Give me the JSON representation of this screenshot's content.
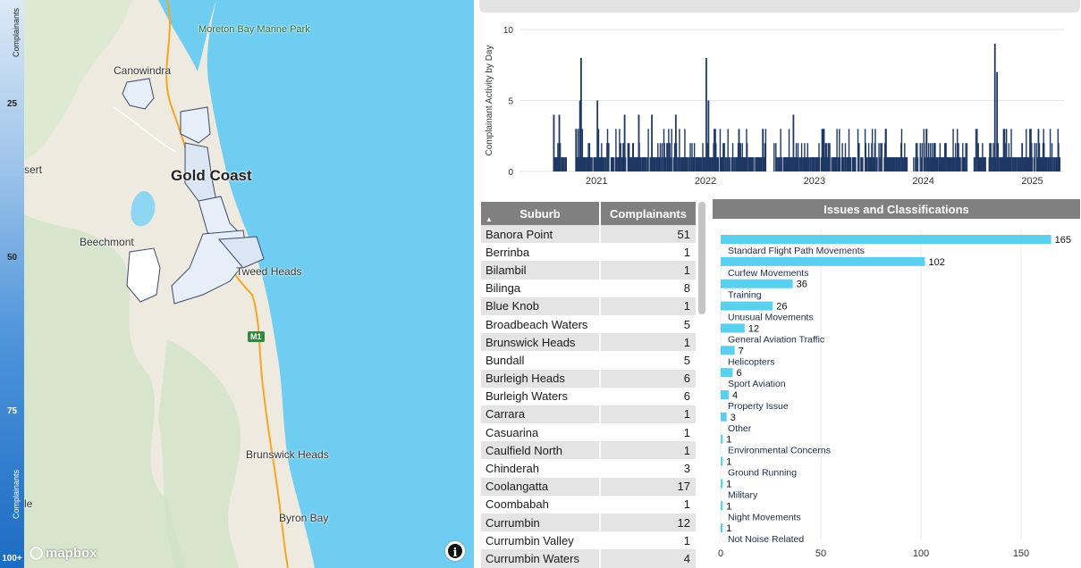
{
  "legend": {
    "ticks": [
      "25",
      "50",
      "75",
      "100+"
    ],
    "label": "Complainants"
  },
  "map": {
    "labels": {
      "moreton_bay": "Moreton Bay Marine Park",
      "canowindra": "Canowindra",
      "gold_coast": "Gold Coast",
      "beechmont": "Beechmont",
      "tweed_heads": "Tweed Heads",
      "brunswick_heads": "Brunswick Heads",
      "byron_bay": "Byron Bay",
      "sert": "sert",
      "le": "le"
    },
    "highway_shield": "M1",
    "logo": "mapbox",
    "info": "i",
    "colors": {
      "water": "#6ecdf0",
      "land": "#eeeadf",
      "hills": "#cfe3c5",
      "region_fill": "#e6eef8",
      "region_stroke": "#3a4a6e",
      "road": "#f5a623"
    }
  },
  "activity_chart": {
    "chart_data": {
      "type": "bar",
      "ylabel": "Complainant Activity by Day",
      "yticks": [
        0,
        5,
        10
      ],
      "ylim": [
        0,
        10
      ],
      "x_tick_labels": [
        "2021",
        "2022",
        "2023",
        "2024",
        "2025"
      ],
      "color": "#1f3864",
      "grid": true,
      "spikes": [
        {
          "x": 2020.85,
          "y": 8
        },
        {
          "x": 2020.84,
          "y": 5
        },
        {
          "x": 2021.0,
          "y": 5
        },
        {
          "x": 2020.6,
          "y": 4
        },
        {
          "x": 2020.65,
          "y": 4
        },
        {
          "x": 2021.25,
          "y": 4
        },
        {
          "x": 2021.38,
          "y": 4
        },
        {
          "x": 2021.5,
          "y": 4
        },
        {
          "x": 2021.72,
          "y": 4
        },
        {
          "x": 2022.0,
          "y": 8
        },
        {
          "x": 2022.02,
          "y": 5
        },
        {
          "x": 2022.3,
          "y": 3
        },
        {
          "x": 2022.52,
          "y": 3
        },
        {
          "x": 2022.8,
          "y": 4
        },
        {
          "x": 2023.08,
          "y": 3
        },
        {
          "x": 2023.4,
          "y": 2
        },
        {
          "x": 2023.65,
          "y": 3
        },
        {
          "x": 2024.0,
          "y": 2
        },
        {
          "x": 2024.2,
          "y": 2
        },
        {
          "x": 2024.65,
          "y": 9
        },
        {
          "x": 2024.67,
          "y": 7
        },
        {
          "x": 2024.9,
          "y": 2
        },
        {
          "x": 2025.05,
          "y": 3
        },
        {
          "x": 2025.1,
          "y": 2
        }
      ]
    }
  },
  "suburb_table": {
    "headers": {
      "suburb": "Suburb",
      "count": "Complainants"
    },
    "rows": [
      {
        "suburb": "Banora Point",
        "count": "51"
      },
      {
        "suburb": "Berrinba",
        "count": "1"
      },
      {
        "suburb": "Bilambil",
        "count": "1"
      },
      {
        "suburb": "Bilinga",
        "count": "8"
      },
      {
        "suburb": "Blue Knob",
        "count": "1"
      },
      {
        "suburb": "Broadbeach Waters",
        "count": "5"
      },
      {
        "suburb": "Brunswick Heads",
        "count": "1"
      },
      {
        "suburb": "Bundall",
        "count": "5"
      },
      {
        "suburb": "Burleigh Heads",
        "count": "6"
      },
      {
        "suburb": "Burleigh Waters",
        "count": "6"
      },
      {
        "suburb": "Carrara",
        "count": "1"
      },
      {
        "suburb": "Casuarina",
        "count": "1"
      },
      {
        "suburb": "Caulfield North",
        "count": "1"
      },
      {
        "suburb": "Chinderah",
        "count": "3"
      },
      {
        "suburb": "Coolangatta",
        "count": "17"
      },
      {
        "suburb": "Coombabah",
        "count": "1"
      },
      {
        "suburb": "Currumbin",
        "count": "12"
      },
      {
        "suburb": "Currumbin Valley",
        "count": "1"
      },
      {
        "suburb": "Currumbin Waters",
        "count": "4"
      }
    ]
  },
  "issues_chart": {
    "title": "Issues and Classifications",
    "chart_data": {
      "type": "bar",
      "orientation": "horizontal",
      "categories": [
        "Standard Flight Path Movements",
        "Curfew Movements",
        "Training",
        "Unusual Movements",
        "General Aviation Traffic",
        "Helicopters",
        "Sport Aviation",
        "Property Issue",
        "Other",
        "Environmental Concerns",
        "Ground Running",
        "Military",
        "Night Movements",
        "Not Noise Related"
      ],
      "values": [
        165,
        102,
        36,
        26,
        12,
        7,
        6,
        4,
        3,
        1,
        1,
        1,
        1,
        1
      ],
      "xticks": [
        0,
        50,
        100,
        150
      ],
      "xlim": [
        0,
        175
      ],
      "color": "#5bd0ee",
      "grid": true
    }
  }
}
